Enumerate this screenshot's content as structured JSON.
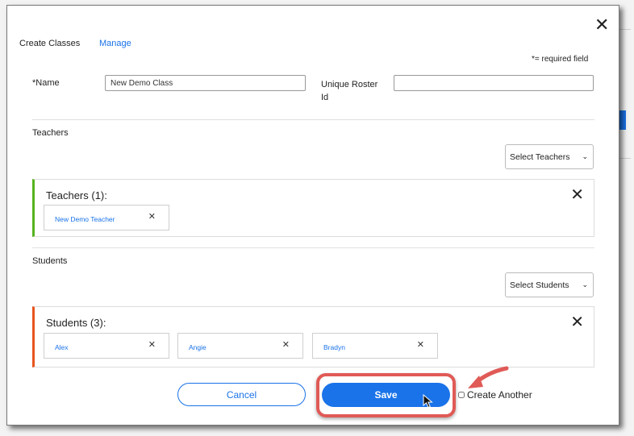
{
  "tabs": {
    "create": "Create Classes",
    "manage": "Manage"
  },
  "required_note": "*= required field",
  "form": {
    "name_label": "*Name",
    "name_value": "New Demo Class",
    "roster_label": "Unique Roster Id",
    "roster_value": ""
  },
  "teachers": {
    "section_label": "Teachers",
    "select_label": "Select Teachers",
    "box_title": "Teachers (1):",
    "items": [
      "New Demo Teacher"
    ]
  },
  "students": {
    "section_label": "Students",
    "select_label": "Select Students",
    "box_title": "Students (3):",
    "items": [
      "Alex",
      "Angie",
      "Bradyn"
    ]
  },
  "footer": {
    "cancel_label": "Cancel",
    "save_label": "Save",
    "create_another_label": "Create Another",
    "create_another_checked": false
  },
  "icons": {
    "close": "close-icon",
    "chevron": "chevron-down-icon",
    "remove": "remove-icon",
    "cursor": "cursor-pointer-icon",
    "arrow": "annotation-arrow-icon"
  },
  "colors": {
    "accent": "#1a73e8",
    "teachers_bar": "#57b31f",
    "students_bar": "#e8541e",
    "highlight": "#e05a56"
  }
}
